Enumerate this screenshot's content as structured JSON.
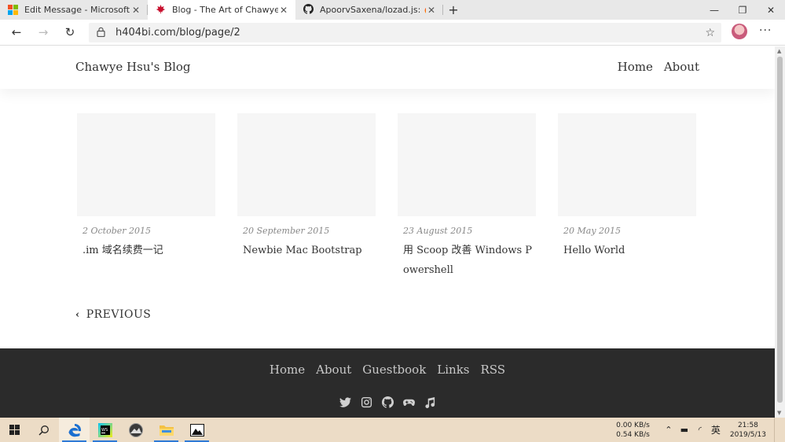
{
  "browser": {
    "tabs": [
      {
        "title": "Edit Message - Microsoft Tech Co",
        "icon": "microsoft-icon",
        "active": false
      },
      {
        "title": "Blog - The Art of Chawye Hsu",
        "icon": "maple-leaf-icon",
        "active": true
      },
      {
        "title": "ApoorvSaxena/lozad.js: 🔥 Highl",
        "icon": "github-icon",
        "active": false
      }
    ],
    "new_tab": "+",
    "url": "h404bi.com/blog/page/2",
    "more": "···"
  },
  "site": {
    "title": "Chawye Hsu's Blog",
    "nav": [
      "Home",
      "About"
    ]
  },
  "posts": [
    {
      "date": "2 October 2015",
      "title": ".im 域名续费一记"
    },
    {
      "date": "20 September 2015",
      "title": "Newbie Mac Bootstrap"
    },
    {
      "date": "23 August 2015",
      "title": "用 Scoop 改善 Windows Powershell"
    },
    {
      "date": "20 May 2015",
      "title": "Hello World"
    }
  ],
  "pagination": {
    "previous": "PREVIOUS"
  },
  "footer": {
    "nav": [
      "Home",
      "About",
      "Guestbook",
      "Links",
      "RSS"
    ],
    "social": [
      "twitter-icon",
      "instagram-icon",
      "github-icon",
      "gamepad-icon",
      "music-icon"
    ]
  },
  "taskbar": {
    "upload": "0.00 KB/s",
    "download": "0.54 KB/s",
    "ime": "英",
    "time": "21:58",
    "date": "2019/5/13"
  },
  "colors": {
    "footer_bg": "#2b2b2b",
    "taskbar_bg": "#ecdcc6",
    "thumb_bg": "#f6f6f6"
  }
}
